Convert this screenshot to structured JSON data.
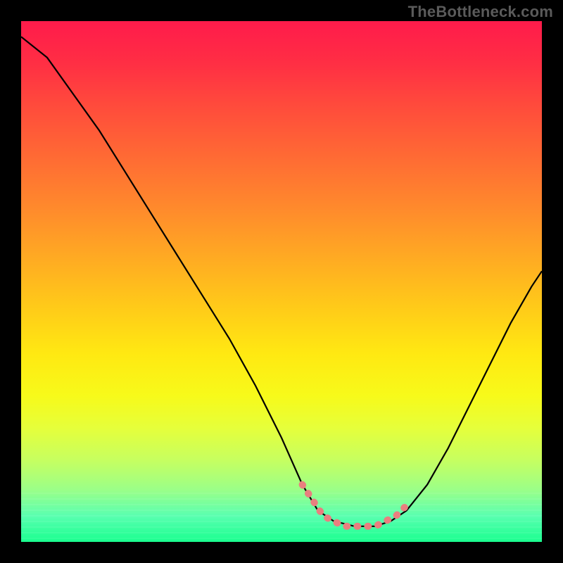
{
  "watermark": {
    "text": "TheBottleneck.com"
  },
  "chart_data": {
    "type": "line",
    "title": "",
    "xlabel": "",
    "ylabel": "",
    "xlim": [
      0,
      100
    ],
    "ylim": [
      0,
      100
    ],
    "grid": false,
    "legend": false,
    "series": [
      {
        "name": "bottleneck-curve",
        "color": "#000000",
        "x": [
          0,
          5,
          10,
          15,
          20,
          25,
          30,
          35,
          40,
          45,
          50,
          54,
          57,
          60,
          64,
          68,
          71,
          74,
          78,
          82,
          86,
          90,
          94,
          98,
          100
        ],
        "values": [
          97,
          93,
          86,
          79,
          71,
          63,
          55,
          47,
          39,
          30,
          20,
          11,
          6,
          4,
          3,
          3,
          4,
          6,
          11,
          18,
          26,
          34,
          42,
          49,
          52
        ]
      },
      {
        "name": "trough-highlight",
        "color": "#e97f7f",
        "x": [
          54,
          56,
          58,
          60,
          62,
          64,
          66,
          68,
          70,
          72,
          74
        ],
        "values": [
          11,
          8,
          5,
          4,
          3,
          3,
          3,
          3,
          4,
          5,
          7
        ]
      }
    ],
    "background_gradient": {
      "top": "#ff1b4b",
      "bottom": "#1aff8f",
      "direction": "vertical"
    }
  }
}
